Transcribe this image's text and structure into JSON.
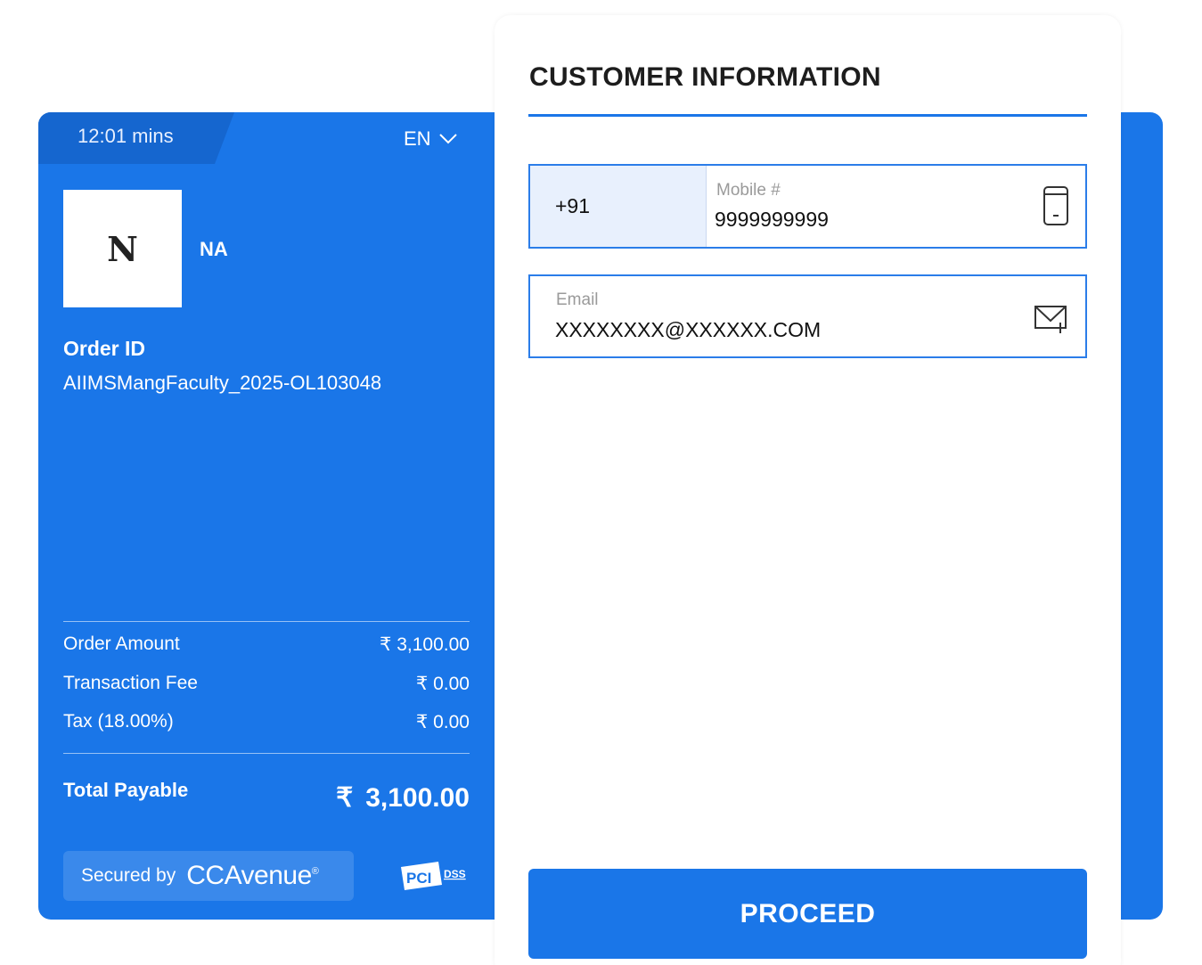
{
  "timer": {
    "text": "12:01 mins"
  },
  "language": {
    "selected": "EN"
  },
  "merchant": {
    "logo_letter": "N",
    "name": "NA"
  },
  "order": {
    "label": "Order ID",
    "id": "AIIMSMangFaculty_2025-OL103048"
  },
  "summary": {
    "rows": [
      {
        "label": "Order Amount",
        "value": "₹ 3,100.00"
      },
      {
        "label": "Transaction Fee",
        "value": "₹ 0.00"
      },
      {
        "label": "Tax (18.00%)",
        "value": "₹ 0.00"
      }
    ],
    "total_label": "Total Payable",
    "total_currency": "₹",
    "total_amount": "3,100.00"
  },
  "footer": {
    "secured_by": "Secured by",
    "brand": "CCAvenue",
    "brand_mark": "®",
    "pci_text": "PCI",
    "pci_dss": "DSS"
  },
  "form": {
    "title": "CUSTOMER INFORMATION",
    "country_code": "+91",
    "mobile_label": "Mobile #",
    "mobile_value": "9999999999",
    "email_label": "Email",
    "email_value": "XXXXXXXX@XXXXXX.COM",
    "proceed_label": "PROCEED"
  },
  "colors": {
    "primary_blue": "#1a76e8",
    "dark_blue": "#1566cf",
    "field_border": "#2b7de9",
    "country_code_bg": "#e8f0fd"
  },
  "icons": [
    "chevron-down-icon",
    "mobile-phone-icon",
    "mail-icon",
    "pci-dss-logo"
  ]
}
